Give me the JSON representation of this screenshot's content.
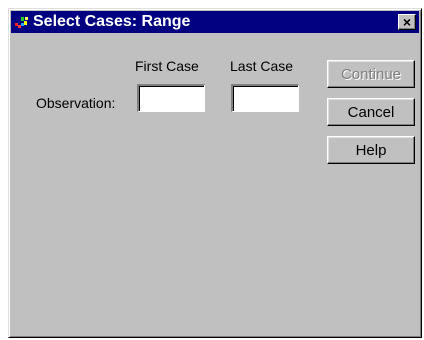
{
  "window": {
    "title": "Select Cases: Range",
    "close_glyph": "×",
    "app_icon": "spss-app-icon",
    "colors": {
      "titlebar": "#000080",
      "face": "#c0c0c0",
      "disabled_text": "#808080"
    }
  },
  "form": {
    "first_case_header": "First Case",
    "last_case_header": "Last Case",
    "row_label": "Observation:",
    "first_case_value": "",
    "last_case_value": ""
  },
  "buttons": {
    "continue": {
      "label": "Continue",
      "enabled": false
    },
    "cancel": {
      "label": "Cancel",
      "enabled": true
    },
    "help": {
      "label": "Help",
      "enabled": true
    }
  }
}
